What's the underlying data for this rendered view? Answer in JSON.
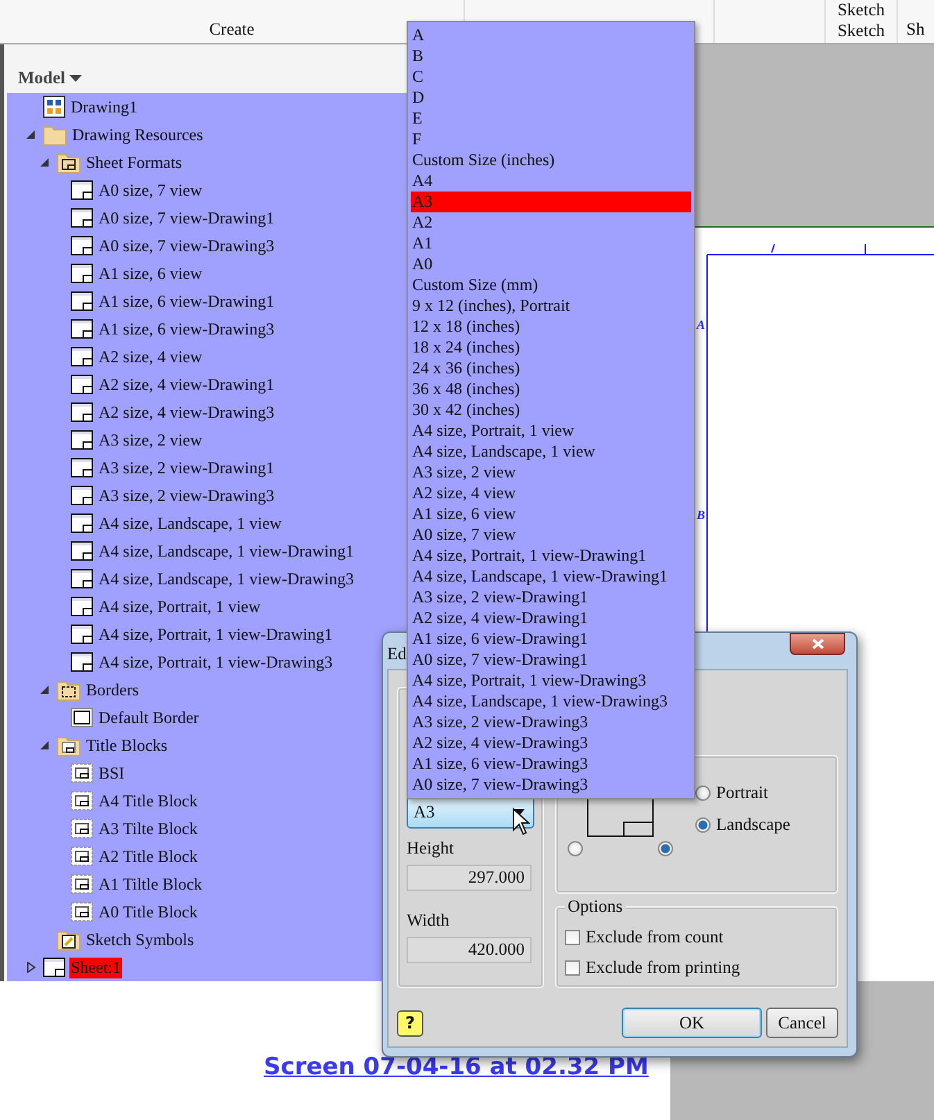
{
  "ribbon": {
    "panels": [
      {
        "label": "Create"
      },
      {
        "label": "Sketch",
        "top_label": "Sketch"
      },
      {
        "label": "Sh"
      }
    ]
  },
  "browser": {
    "title": "Model",
    "tree": [
      {
        "label": "Drawing1",
        "kind": "drawing",
        "selected": false
      },
      {
        "label": "Drawing Resources",
        "kind": "folder",
        "expanded": true,
        "selected": false,
        "children": [
          {
            "label": "Sheet Formats",
            "kind": "format-folder",
            "expanded": true,
            "selected": false,
            "children": [
              {
                "label": "A0 size, 7 view",
                "kind": "format",
                "selected": false
              },
              {
                "label": "A0 size, 7 view-Drawing1",
                "kind": "format",
                "selected": false
              },
              {
                "label": "A0 size, 7 view-Drawing3",
                "kind": "format",
                "selected": false
              },
              {
                "label": "A1 size, 6 view",
                "kind": "format",
                "selected": false
              },
              {
                "label": "A1 size, 6 view-Drawing1",
                "kind": "format",
                "selected": false
              },
              {
                "label": "A1 size, 6 view-Drawing3",
                "kind": "format",
                "selected": false
              },
              {
                "label": "A2 size, 4 view",
                "kind": "format",
                "selected": false
              },
              {
                "label": "A2 size, 4 view-Drawing1",
                "kind": "format",
                "selected": false
              },
              {
                "label": "A2 size, 4 view-Drawing3",
                "kind": "format",
                "selected": false
              },
              {
                "label": "A3 size, 2 view",
                "kind": "format",
                "selected": false
              },
              {
                "label": "A3 size, 2 view-Drawing1",
                "kind": "format",
                "selected": false
              },
              {
                "label": "A3 size, 2 view-Drawing3",
                "kind": "format",
                "selected": false
              },
              {
                "label": "A4 size, Landscape, 1 view",
                "kind": "format",
                "selected": false
              },
              {
                "label": "A4 size, Landscape, 1 view-Drawing1",
                "kind": "format",
                "selected": false
              },
              {
                "label": "A4 size, Landscape, 1 view-Drawing3",
                "kind": "format",
                "selected": false
              },
              {
                "label": "A4 size, Portrait, 1 view",
                "kind": "format",
                "selected": false
              },
              {
                "label": "A4 size, Portrait, 1 view-Drawing1",
                "kind": "format",
                "selected": false
              },
              {
                "label": "A4 size, Portrait, 1 view-Drawing3",
                "kind": "format",
                "selected": false
              }
            ]
          },
          {
            "label": "Borders",
            "kind": "border-folder",
            "expanded": true,
            "selected": false,
            "children": [
              {
                "label": "Default Border",
                "kind": "border",
                "selected": false
              }
            ]
          },
          {
            "label": "Title Blocks",
            "kind": "titleblock-folder",
            "expanded": true,
            "selected": false,
            "children": [
              {
                "label": "BSI",
                "kind": "titleblock",
                "selected": false
              },
              {
                "label": "A4 Title Block",
                "kind": "titleblock",
                "selected": false
              },
              {
                "label": "A3 Tilte Block",
                "kind": "titleblock",
                "selected": false
              },
              {
                "label": "A2 Title Block",
                "kind": "titleblock",
                "selected": false
              },
              {
                "label": "A1 Tiltle Block",
                "kind": "titleblock",
                "selected": false
              },
              {
                "label": "A0 Title Block",
                "kind": "titleblock",
                "selected": false
              }
            ]
          },
          {
            "label": "Sketch Symbols",
            "kind": "symbols-folder",
            "selected": false
          }
        ]
      },
      {
        "label": "Sheet:1",
        "kind": "sheet",
        "expanded": false,
        "selected": true
      }
    ]
  },
  "sheet": {
    "zone_labels": [
      "A",
      "B"
    ]
  },
  "size_dropdown": {
    "options": [
      {
        "label": "A",
        "selected": false
      },
      {
        "label": "B",
        "selected": false
      },
      {
        "label": "C",
        "selected": false
      },
      {
        "label": "D",
        "selected": false
      },
      {
        "label": "E",
        "selected": false
      },
      {
        "label": "F",
        "selected": false
      },
      {
        "label": "Custom Size (inches)",
        "selected": false
      },
      {
        "label": "A4",
        "selected": false
      },
      {
        "label": "A3",
        "selected": true
      },
      {
        "label": "A2",
        "selected": false
      },
      {
        "label": "A1",
        "selected": false
      },
      {
        "label": "A0",
        "selected": false
      },
      {
        "label": "Custom Size (mm)",
        "selected": false
      },
      {
        "label": "9 x 12 (inches), Portrait",
        "selected": false
      },
      {
        "label": "12 x 18 (inches)",
        "selected": false
      },
      {
        "label": "18 x 24 (inches)",
        "selected": false
      },
      {
        "label": "24 x 36 (inches)",
        "selected": false
      },
      {
        "label": "36 x 48 (inches)",
        "selected": false
      },
      {
        "label": "30 x 42 (inches)",
        "selected": false
      },
      {
        "label": "A4 size, Portrait, 1 view",
        "selected": false
      },
      {
        "label": "A4 size, Landscape, 1 view",
        "selected": false
      },
      {
        "label": "A3 size, 2 view",
        "selected": false
      },
      {
        "label": "A2 size, 4 view",
        "selected": false
      },
      {
        "label": "A1 size, 6 view",
        "selected": false
      },
      {
        "label": "A0 size, 7 view",
        "selected": false
      },
      {
        "label": "A4 size, Portrait, 1 view-Drawing1",
        "selected": false
      },
      {
        "label": "A4 size, Landscape, 1 view-Drawing1",
        "selected": false
      },
      {
        "label": "A3 size, 2 view-Drawing1",
        "selected": false
      },
      {
        "label": "A2 size, 4 view-Drawing1",
        "selected": false
      },
      {
        "label": "A1 size, 6 view-Drawing1",
        "selected": false
      },
      {
        "label": "A0 size, 7 view-Drawing1",
        "selected": false
      },
      {
        "label": "A4 size, Portrait, 1 view-Drawing3",
        "selected": false
      },
      {
        "label": "A4 size, Landscape, 1 view-Drawing3",
        "selected": false
      },
      {
        "label": "A3 size, 2 view-Drawing3",
        "selected": false
      },
      {
        "label": "A2 size, 4 view-Drawing3",
        "selected": false
      },
      {
        "label": "A1 size, 6 view-Drawing3",
        "selected": false
      },
      {
        "label": "A0 size, 7 view-Drawing3",
        "selected": false
      }
    ]
  },
  "dialog": {
    "title": "Ed",
    "size_combo": {
      "value": "A3"
    },
    "height": {
      "label": "Height",
      "value": "297.000"
    },
    "width": {
      "label": "Width",
      "value": "420.000"
    },
    "orientation": [
      {
        "label": "Portrait",
        "selected": false
      },
      {
        "label": "Landscape",
        "selected": true
      }
    ],
    "corner_radios": [
      {
        "selected": false
      },
      {
        "selected": true
      }
    ],
    "options": {
      "title": "Options",
      "checkboxes": [
        {
          "label": "Exclude from count",
          "checked": false
        },
        {
          "label": "Exclude from printing",
          "checked": false
        }
      ]
    },
    "help_glyph": "?",
    "buttons": [
      {
        "label": "OK",
        "default": true
      },
      {
        "label": "Cancel",
        "default": false
      }
    ]
  },
  "footer": {
    "link": "Screen 07-04-16 at 02.32 PM"
  }
}
